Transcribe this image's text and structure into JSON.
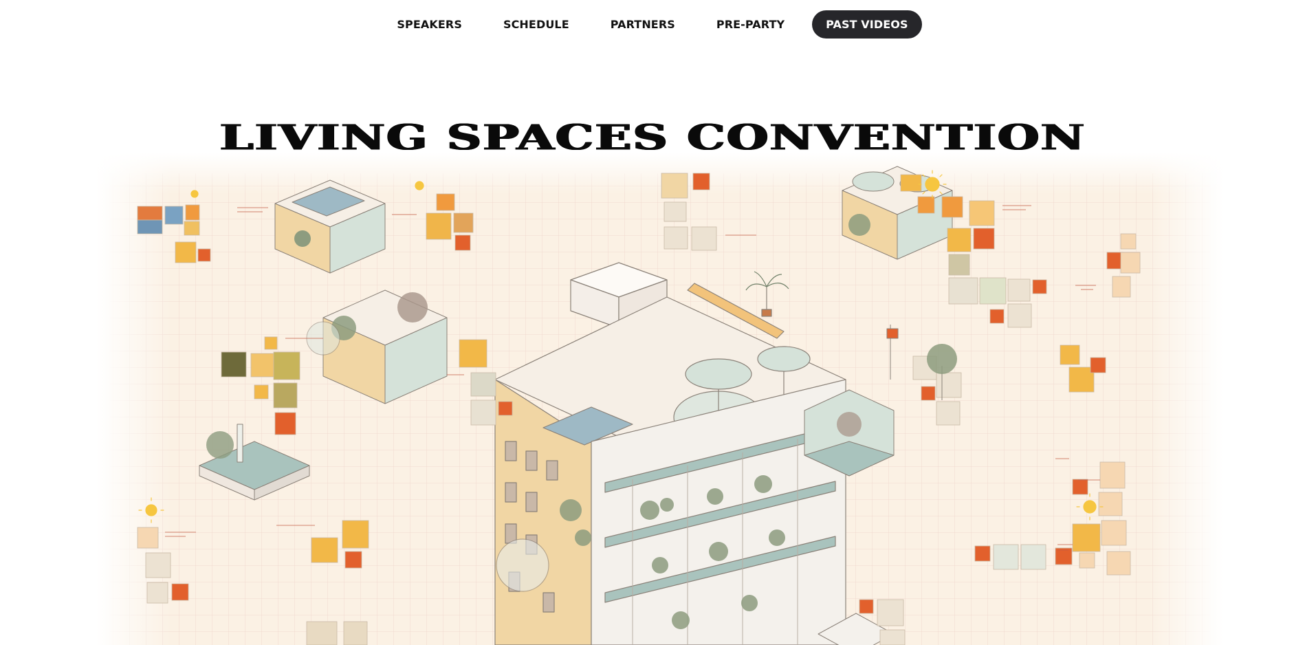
{
  "nav": {
    "items": [
      {
        "label": "SPEAKERS",
        "name": "nav-speakers",
        "active": false
      },
      {
        "label": "SCHEDULE",
        "name": "nav-schedule",
        "active": false
      },
      {
        "label": "PARTNERS",
        "name": "nav-partners",
        "active": false
      },
      {
        "label": "PRE-PARTY",
        "name": "nav-pre-party",
        "active": false
      },
      {
        "label": "PAST VIDEOS",
        "name": "nav-past-videos",
        "active": true
      }
    ]
  },
  "page": {
    "title": "LIVING SPACES CONVENTION"
  },
  "hero": {
    "illustration": "isometric-building-illustration",
    "colors": {
      "background": "#fbf1e4",
      "grid": "#f0d9cf",
      "accent_orange": "#e2602c",
      "accent_yellow": "#f2b848",
      "teal": "#a9c3bd",
      "sun": "#f6c640"
    }
  }
}
